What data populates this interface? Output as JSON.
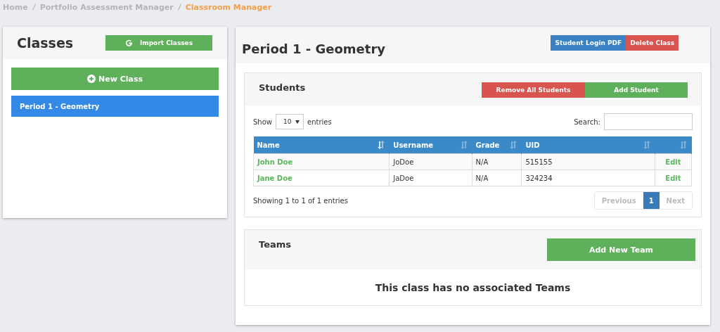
{
  "breadcrumb": [
    {
      "label": "Home",
      "current": false
    },
    {
      "label": "Portfolio Assessment Manager",
      "current": false
    },
    {
      "label": "Classroom Manager",
      "current": true
    }
  ],
  "classes_panel": {
    "title": "Classes",
    "import_button": "Import Classes",
    "new_button": "New Class",
    "items": [
      {
        "label": "Period 1 - Geometry",
        "selected": true
      }
    ]
  },
  "class_panel": {
    "title": "Period 1 - Geometry",
    "buttons": [
      {
        "label": "Student Login PDF",
        "kind": "primary"
      },
      {
        "label": "Delete Class",
        "kind": "danger"
      }
    ]
  },
  "students": {
    "title": "Students",
    "buttons": [
      {
        "label": "Remove All Students",
        "kind": "danger"
      },
      {
        "label": "Add Student",
        "kind": "success"
      }
    ],
    "show_label": "Show",
    "page_size": "10",
    "entries_label": "entries",
    "search_label": "Search:",
    "columns": [
      {
        "label": "Name",
        "sorted": true
      },
      {
        "label": "Username",
        "sorted": false
      },
      {
        "label": "Grade",
        "sorted": false
      },
      {
        "label": "UID",
        "sorted": false
      },
      {
        "sorted": false
      }
    ],
    "rows": [
      {
        "name": "John Doe",
        "username": "JoDoe",
        "grade": "N/A",
        "uid": "515155",
        "action": "Edit"
      },
      {
        "name": "Jane Doe",
        "username": "JaDoe",
        "grade": "N/A",
        "uid": "324234",
        "action": "Edit"
      }
    ],
    "info": "Showing 1 to 1 of 1 entries",
    "pagination": [
      {
        "label": "Previous",
        "selected": false,
        "disabled": true
      },
      {
        "label": "1",
        "selected": true,
        "disabled": false
      },
      {
        "label": "Next",
        "selected": false,
        "disabled": true
      }
    ]
  },
  "teams": {
    "title": "Teams",
    "button": "Add New Team",
    "empty_message": "This class has no associated Teams"
  }
}
